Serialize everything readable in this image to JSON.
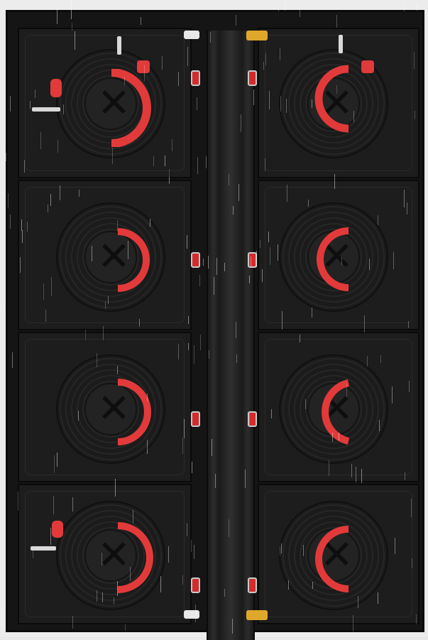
{
  "scene": {
    "subject": "",
    "colors": {
      "frame": "#151515",
      "panel": "#1d1d1d",
      "accent_red": "#e23a3a",
      "connector_yellow": "#e0a82b",
      "rain": "#ffffff"
    }
  }
}
